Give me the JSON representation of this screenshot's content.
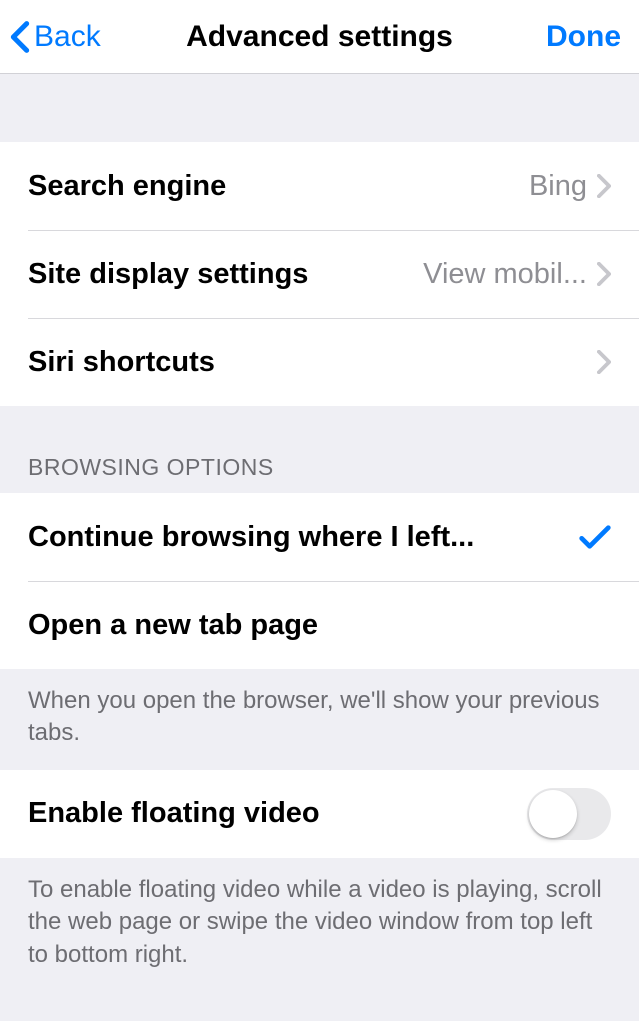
{
  "navbar": {
    "back_label": "Back",
    "title": "Advanced settings",
    "done_label": "Done"
  },
  "general": {
    "search_engine_label": "Search engine",
    "search_engine_value": "Bing",
    "site_display_label": "Site display settings",
    "site_display_value": "View mobil...",
    "siri_shortcuts_label": "Siri shortcuts"
  },
  "browsing": {
    "header": "BROWSING OPTIONS",
    "option_continue": "Continue browsing where I left...",
    "option_new_tab": "Open a new tab page",
    "footer": "When you open the browser, we'll show your previous tabs."
  },
  "floating_video": {
    "label": "Enable floating video",
    "enabled": false,
    "footer": "To enable floating video while a video is playing, scroll the web page or swipe the video window from top left to bottom right."
  }
}
